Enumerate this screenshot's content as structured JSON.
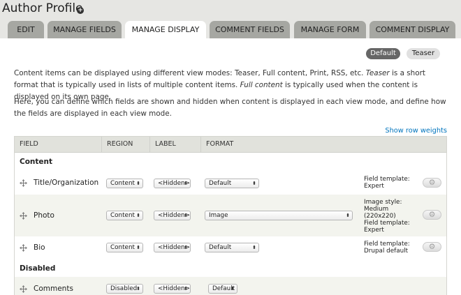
{
  "header": {
    "title": "Author Profile",
    "shortcut_icon": "plus-circle-icon"
  },
  "tabs": [
    {
      "label": "Edit",
      "active": false
    },
    {
      "label": "Manage fields",
      "active": false
    },
    {
      "label": "Manage display",
      "active": true
    },
    {
      "label": "Comment fields",
      "active": false
    },
    {
      "label": "Manage form",
      "active": false
    },
    {
      "label": "Comment display",
      "active": false
    }
  ],
  "view_modes": [
    {
      "label": "Default",
      "active": true
    },
    {
      "label": "Teaser",
      "active": false
    }
  ],
  "description": {
    "p1_a": "Content items can be displayed using different view modes: Teaser, Full content, Print, RSS, etc. ",
    "p1_teaser": "Teaser",
    "p1_b": " is a short format that is typically used in lists of multiple content items. ",
    "p1_full": "Full content",
    "p1_c": " is typically used when the content is displayed on its own page.",
    "p2": "Here, you can define which fields are shown and hidden when content is displayed in each view mode, and define how the fields are displayed in each view mode."
  },
  "show_row_weights": "Show row weights",
  "table": {
    "columns": [
      "Field",
      "Region",
      "Label",
      "Format"
    ],
    "regions": {
      "content": "Content",
      "disabled": "Disabled"
    },
    "rows": [
      {
        "field": "Title/Organization",
        "region": "Content",
        "label": "<Hidden>",
        "format": "Default",
        "summary": [
          "Field template:",
          "Expert"
        ]
      },
      {
        "field": "Photo",
        "region": "Content",
        "label": "<Hidden>",
        "format": "Image",
        "summary": [
          "Image style:",
          "Medium",
          "(220x220)",
          "Field template:",
          "Expert"
        ]
      },
      {
        "field": "Bio",
        "region": "Content",
        "label": "<Hidden>",
        "format": "Default",
        "summary": [
          "Field template:",
          "Drupal default"
        ]
      },
      {
        "field": "Comments",
        "region": "Disabled",
        "label": "<Hidden>",
        "format": "Default",
        "summary": []
      }
    ]
  },
  "icons": {
    "drag": "move-arrows-icon",
    "settings": "gear-icon",
    "select_arrow": "updown-arrows-icon"
  },
  "colors": {
    "header_bg": "#e6e6e3",
    "tab_bg": "#a6a7a2",
    "link": "#0074bd",
    "view_mode_active": "#666666"
  }
}
